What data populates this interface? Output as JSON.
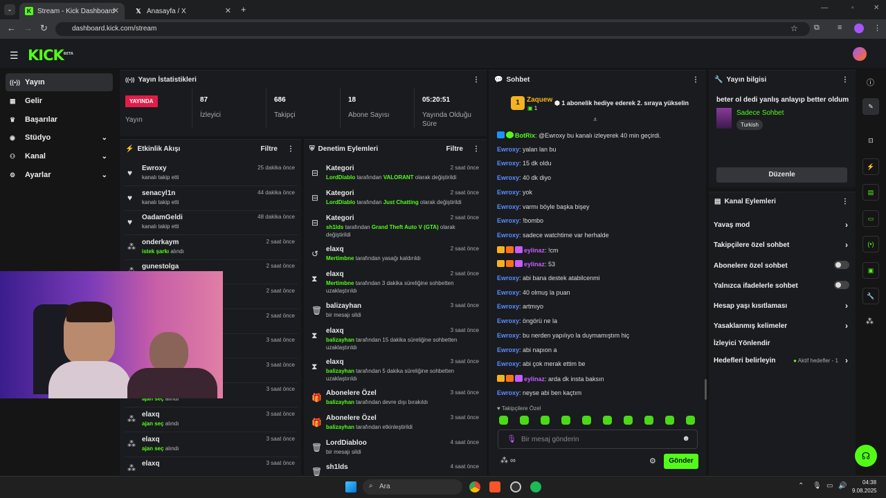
{
  "browser": {
    "tabs": [
      {
        "title": "Stream - Kick Dashboard"
      },
      {
        "title": "Anasayfa / X"
      }
    ],
    "url": "dashboard.kick.com/stream"
  },
  "header": {
    "logo": "KICK",
    "logo_sup": "BETA"
  },
  "nav": [
    {
      "label": "Yayın",
      "icon": "broadcast-icon"
    },
    {
      "label": "Gelir",
      "icon": "revenue-icon"
    },
    {
      "label": "Başarılar",
      "icon": "trophy-icon"
    },
    {
      "label": "Stüdyo",
      "icon": "studio-icon"
    },
    {
      "label": "Kanal",
      "icon": "channel-icon"
    },
    {
      "label": "Ayarlar",
      "icon": "gear-icon"
    }
  ],
  "stats": {
    "title": "Yayın İstatistikleri",
    "live_label": "YAYINDA",
    "live_sub": "Yayın",
    "items": [
      {
        "value": "87",
        "label": "İzleyici"
      },
      {
        "value": "686",
        "label": "Takipçi"
      },
      {
        "value": "18",
        "label": "Abone Sayısı"
      },
      {
        "value": "05:20:51",
        "label": "Yayında Olduğu Süre"
      }
    ]
  },
  "activity": {
    "title": "Etkinlik Akışı",
    "filter": "Filtre",
    "rows": [
      {
        "name": "Ewroxy",
        "desc": "kanalı takip etti",
        "time": "25 dakika önce",
        "icon": "heart-icon"
      },
      {
        "name": "senacyl1n",
        "desc": "kanalı takip etti",
        "time": "44 dakika önce",
        "icon": "heart-icon"
      },
      {
        "name": "OadamGeldi",
        "desc": "kanalı takip etti",
        "time": "48 dakika önce",
        "icon": "heart-icon"
      },
      {
        "name": "onderkaym",
        "highlight": "istek şarkı",
        "desc": " alındı",
        "time": "2 saat önce",
        "icon": "reward-icon"
      },
      {
        "name": "gunestolga",
        "desc": "",
        "time": "2 saat önce",
        "icon": "reward-icon"
      },
      {
        "name": "",
        "desc": "",
        "time": "2 saat önce",
        "icon": ""
      },
      {
        "name": "",
        "desc": "",
        "time": "2 saat önce",
        "icon": ""
      },
      {
        "name": "",
        "desc": "",
        "time": "3 saat önce",
        "icon": ""
      },
      {
        "name": "",
        "desc": "",
        "time": "3 saat önce",
        "icon": ""
      },
      {
        "name": "",
        "highlight": "ajan seç",
        "desc": " alındı",
        "time": "3 saat önce",
        "icon": ""
      },
      {
        "name": "elaxq",
        "highlight": "ajan seç",
        "desc": " alındı",
        "time": "3 saat önce",
        "icon": "reward-icon"
      },
      {
        "name": "elaxq",
        "highlight": "ajan seç",
        "desc": " alındı",
        "time": "3 saat önce",
        "icon": "reward-icon"
      },
      {
        "name": "elaxq",
        "desc": "",
        "time": "3 saat önce",
        "icon": "reward-icon"
      }
    ]
  },
  "moderation": {
    "title": "Denetim Eylemleri",
    "filter": "Filtre",
    "rows": [
      {
        "name": "Kategori",
        "user": "LordDiablo",
        "mid": " tarafından ",
        "target": "VALORANT",
        "end": " olarak değiştirildi",
        "time": "2 saat önce"
      },
      {
        "name": "Kategori",
        "user": "LordDiablo",
        "mid": " tarafından ",
        "target": "Just Chatting",
        "end": " olarak değiştirildi",
        "time": "2 saat önce"
      },
      {
        "name": "Kategori",
        "user": "sh1lds",
        "mid": " tarafından ",
        "target": "Grand Theft Auto V (GTA)",
        "end": " olarak değiştirildi",
        "time": "2 saat önce"
      },
      {
        "name": "elaxq",
        "user": "Mertimbne",
        "mid": " tarafından yasağı kaldırıldı",
        "target": "",
        "end": "",
        "time": "2 saat önce"
      },
      {
        "name": "elaxq",
        "user": "Mertimbne",
        "mid": " tarafından 3 dakika süreliğine sohbetten uzaklaştırıldı",
        "target": "",
        "end": "",
        "time": "2 saat önce"
      },
      {
        "name": "balizayhan",
        "user": "",
        "mid": "bir mesajı sildi",
        "target": "",
        "end": "",
        "time": "3 saat önce"
      },
      {
        "name": "elaxq",
        "user": "balizayhan",
        "mid": " tarafından 15 dakika süreliğine sohbetten uzaklaştırıldı",
        "target": "",
        "end": "",
        "time": "3 saat önce"
      },
      {
        "name": "elaxq",
        "user": "balizayhan",
        "mid": " tarafından 5 dakika süreliğine sohbetten uzaklaştırıldı",
        "target": "",
        "end": "",
        "time": "3 saat önce"
      },
      {
        "name": "Abonelere Özel",
        "user": "balizayhan",
        "mid": " tarafından devre dışı bırakıldı",
        "target": "",
        "end": "",
        "time": "3 saat önce"
      },
      {
        "name": "Abonelere Özel",
        "user": "balizayhan",
        "mid": " tarafından etkinleştirildi",
        "target": "",
        "end": "",
        "time": "3 saat önce"
      },
      {
        "name": "LordDiabloo",
        "user": "",
        "mid": "bir mesajı sildi",
        "target": "",
        "end": "",
        "time": "4 saat önce"
      },
      {
        "name": "sh1lds",
        "user": "",
        "mid": "",
        "target": "",
        "end": "",
        "time": "4 saat önce"
      }
    ]
  },
  "chat": {
    "title": "Sohbet",
    "pinned_user": "Zaquew",
    "pinned_count": "1",
    "pinned_rank": "1",
    "pinned_text": "1 abonelik hediye ederek 2. sıraya yükselin",
    "messages": [
      {
        "user": "BotRix",
        "text": ": @Ewroxy bu kanalı izleyerek 40 min geçirdi.",
        "type": "g"
      },
      {
        "user": "Ewroxy",
        "text": ": yalan lan bu",
        "type": ""
      },
      {
        "user": "Ewroxy",
        "text": ": 15 dk oldu",
        "type": ""
      },
      {
        "user": "Ewroxy",
        "text": ": 40 dk diyo",
        "type": ""
      },
      {
        "user": "Ewroxy",
        "text": ": yok",
        "type": ""
      },
      {
        "user": "Ewroxy",
        "text": ": varmı böyle başka bişey",
        "type": ""
      },
      {
        "user": "Ewroxy",
        "text": ": !bombo",
        "type": ""
      },
      {
        "user": "Ewroxy",
        "text": ": sadece watchtime var herhalde",
        "type": ""
      },
      {
        "user": "eylinaz",
        "text": ": !cm",
        "type": "p"
      },
      {
        "user": "eylinaz",
        "text": ": 53",
        "type": "p"
      },
      {
        "user": "Ewroxy",
        "text": ": abi bana destek atabilcenmi",
        "type": ""
      },
      {
        "user": "Ewroxy",
        "text": ": 40 olmuş la puan",
        "type": ""
      },
      {
        "user": "Ewroxy",
        "text": ": artmıyo",
        "type": ""
      },
      {
        "user": "Ewroxy",
        "text": ": öngörü ne la",
        "type": ""
      },
      {
        "user": "Ewroxy",
        "text": ": bu nerden yapılıyo la duymamıştım hiç",
        "type": ""
      },
      {
        "user": "Ewroxy",
        "text": ": abi napıon a",
        "type": ""
      },
      {
        "user": "Ewroxy",
        "text": ": abi çok merak ettim be",
        "type": ""
      },
      {
        "user": "eylinaz",
        "text": ": arda dk insta baksın",
        "type": "p"
      },
      {
        "user": "Ewroxy",
        "text": ": neyse abi ben kaçtım",
        "type": ""
      }
    ],
    "mode": "Takipçilere Özel",
    "placeholder": "Bir mesaj gönderin",
    "send": "Gönder"
  },
  "stream_info": {
    "title": "Yayın bilgisi",
    "stream_title": "beter ol dedi yanlış anlayıp better oldum",
    "category": "Sadece Sohbet",
    "tag": "Turkish",
    "edit": "Düzenle"
  },
  "channel_actions": {
    "title": "Kanal Eylemleri",
    "rows": [
      {
        "label": "Yavaş mod",
        "control": "chevron"
      },
      {
        "label": "Takipçilere özel sohbet",
        "control": "chevron"
      },
      {
        "label": "Abonelere özel sohbet",
        "control": "toggle"
      },
      {
        "label": "Yalnızca ifadelerle sohbet",
        "control": "toggle"
      },
      {
        "label": "Hesap yaşı kısıtlaması",
        "control": "chevron"
      },
      {
        "label": "Yasaklanmış kelimeler",
        "control": "chevron"
      },
      {
        "label": "İzleyici Yönlendir",
        "control": "none"
      },
      {
        "label": "Hedefleri belirleyin",
        "control": "chevron",
        "extra": "Aktif hedefler - 1"
      }
    ]
  },
  "taskbar": {
    "search": "Ara",
    "time": "04:38",
    "date": "9.08.2025"
  },
  "colors": {
    "accent": "#53fc18",
    "live": "#e11d48",
    "user": "#5b8cff",
    "sub": "#c75cff"
  }
}
